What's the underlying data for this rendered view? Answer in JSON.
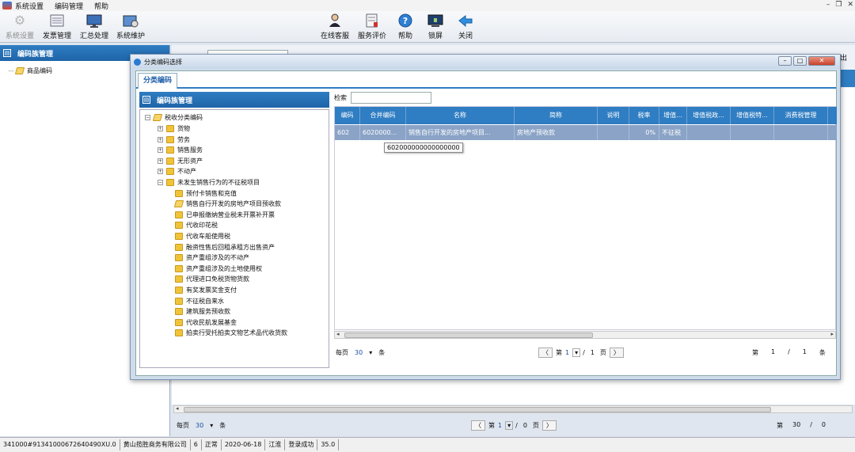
{
  "menubar": {
    "items": [
      "系统设置",
      "编码管理",
      "帮助"
    ]
  },
  "toolbar": {
    "left": [
      {
        "label": "系统设置",
        "icon": "gear-icon",
        "disabled": true
      },
      {
        "label": "发票管理",
        "icon": "invoice-icon",
        "disabled": false
      },
      {
        "label": "汇总处理",
        "icon": "monitor-icon",
        "disabled": false
      },
      {
        "label": "系统维护",
        "icon": "maintenance-icon",
        "disabled": false
      }
    ],
    "right": [
      {
        "label": "在线客服",
        "icon": "service-person-icon"
      },
      {
        "label": "服务评价",
        "icon": "evaluation-icon"
      },
      {
        "label": "帮助",
        "icon": "help-icon"
      },
      {
        "label": "锁屏",
        "icon": "lock-screen-icon"
      },
      {
        "label": "关闭",
        "icon": "back-arrow-icon"
      }
    ]
  },
  "left_panel": {
    "title": "编码族管理",
    "tree_root": "商品编码"
  },
  "main": {
    "right_edge_label": "出",
    "pager": {
      "per_page_label": "每页",
      "per_page": "30",
      "unit": "条",
      "page_label": "第",
      "page": "1",
      "sep": "/",
      "total": "0",
      "page_unit": "页",
      "right_page_label": "第",
      "right_count": "30",
      "right_sep": "/",
      "right_total": "0"
    }
  },
  "dialog": {
    "title": "分类编码选择",
    "tab": "分类编码",
    "tree_title": "编码族管理",
    "tree_root": "税收分类编码",
    "tree_level1": [
      "货物",
      "劳务",
      "销售服务",
      "无形资产",
      "不动产",
      "未发生销售行为的不征税项目"
    ],
    "tree_children": [
      "预付卡销售和充值",
      "销售自行开发的房地产项目预收款",
      "已申报缴纳营业税未开票补开票",
      "代收印花税",
      "代收车船使用税",
      "融资性售后回租承租方出售资产",
      "资产重组涉及的不动产",
      "资产重组涉及的土地使用权",
      "代理进口免税货物货款",
      "有奖发票奖金支付",
      "不征税自来水",
      "建筑服务预收款",
      "代收民航发展基金",
      "拍卖行受托拍卖文物艺术品代收货款"
    ],
    "search_label": "检索",
    "columns": [
      "编码",
      "合并编码",
      "名称",
      "简称",
      "说明",
      "税率",
      "增值...",
      "增值税政...",
      "增值税特...",
      "消费税管理"
    ],
    "rows": [
      {
        "code": "602",
        "merged": "6020000...",
        "name": "销售自行开发的房地产项目...",
        "short": "房地产预收款",
        "desc": "",
        "rate": "0%",
        "vat": "不征税",
        "vat_policy": "",
        "vat_special": "",
        "consumption": ""
      }
    ],
    "tooltip": "602000000000000000",
    "pager": {
      "per_page_label": "每页",
      "per_page": "30",
      "unit": "条",
      "page_label": "第",
      "page": "1",
      "sep": "/",
      "total": "1",
      "page_unit": "页",
      "right_page_label": "第",
      "right_page": "1",
      "right_sep": "/",
      "right_total": "1",
      "right_unit": "条"
    }
  },
  "statusbar": [
    "341000#91341000672640490XU.0",
    "黄山揽胜商务有限公司",
    "6",
    "正常",
    "2020-06-18",
    "江淮",
    "登录成功",
    "35.0"
  ]
}
